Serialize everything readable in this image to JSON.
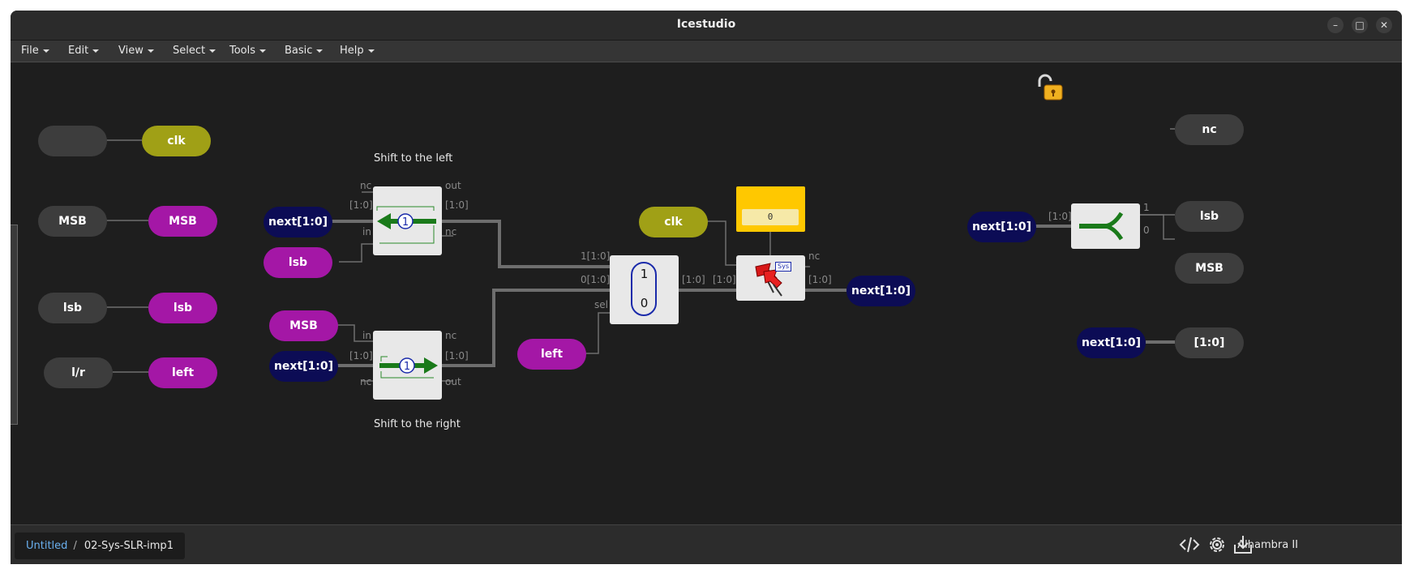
{
  "window": {
    "title": "Icestudio",
    "minimize_glyph": "–",
    "maximize_glyph": "□",
    "close_glyph": "✕"
  },
  "menu": [
    {
      "label": "File"
    },
    {
      "label": "Edit"
    },
    {
      "label": "View"
    },
    {
      "label": "Select"
    },
    {
      "label": "Tools"
    },
    {
      "label": "Basic"
    },
    {
      "label": "Help"
    }
  ],
  "canvas": {
    "comments": {
      "shift_left": "Shift to the left",
      "shift_right": "Shift to the right"
    },
    "inputs": {
      "clk_in": "",
      "msb_in": "MSB",
      "lsb_in": "lsb",
      "lr_in": "l/r"
    },
    "labels": {
      "clk": "clk",
      "msb": "MSB",
      "lsb": "lsb",
      "left": "left",
      "next_sl": "next[1:0]",
      "lsb_sl": "lsb",
      "msb_sr": "MSB",
      "next_sr": "next[1:0]",
      "left_mux": "left",
      "clk_reg": "clk",
      "next_out": "next[1:0]",
      "next_split": "next[1:0]",
      "next_pass": "next[1:0]"
    },
    "outputs": {
      "nc": "nc",
      "lsb": "lsb",
      "msb": "MSB",
      "bus": "[1:0]"
    },
    "shift_left_block": {
      "ports": {
        "top": "nc",
        "bus_in": "[1:0]",
        "in": "in",
        "out": "out",
        "bus_out": "[1:0]",
        "nc_out": "nc"
      },
      "constant": "1"
    },
    "shift_right_block": {
      "ports": {
        "in": "in",
        "bus_in": "[1:0]",
        "nc": "nc",
        "nc_out": "nc",
        "bus_out": "[1:0]",
        "out": "out"
      },
      "constant": "1"
    },
    "mux_block": {
      "ports": {
        "in1": "1[1:0]",
        "in0": "0[1:0]",
        "sel": "sel",
        "out": "[1:0]"
      },
      "top_value": "1",
      "bottom_value": "0"
    },
    "register_block": {
      "ports": {
        "in": "[1:0]",
        "out": "[1:0]",
        "nc": "nc"
      },
      "badge": "Sys",
      "init_value": "0"
    },
    "split_block": {
      "ports": {
        "in": "[1:0]",
        "out1": "1",
        "out0": "0"
      }
    },
    "icons": [
      "padlock-unlocked-icon",
      "pushpin-icon",
      "shift-left-arrow-icon",
      "shift-right-arrow-icon",
      "split-icon"
    ]
  },
  "statusbar": {
    "breadcrumb_root": "Untitled",
    "breadcrumb_separator": "/",
    "breadcrumb_current": "02-Sys-SLR-imp1",
    "board": "Alhambra II"
  },
  "colors": {
    "background": "#1e1e1e",
    "wire": "#777777",
    "magenta_label": "#a417a6",
    "navy_label": "#0c0c55",
    "olive_label": "#a0a016",
    "gray_port": "#3d3d3d",
    "constant_yellow": "#ffc800",
    "link": "#6ab0ef"
  }
}
